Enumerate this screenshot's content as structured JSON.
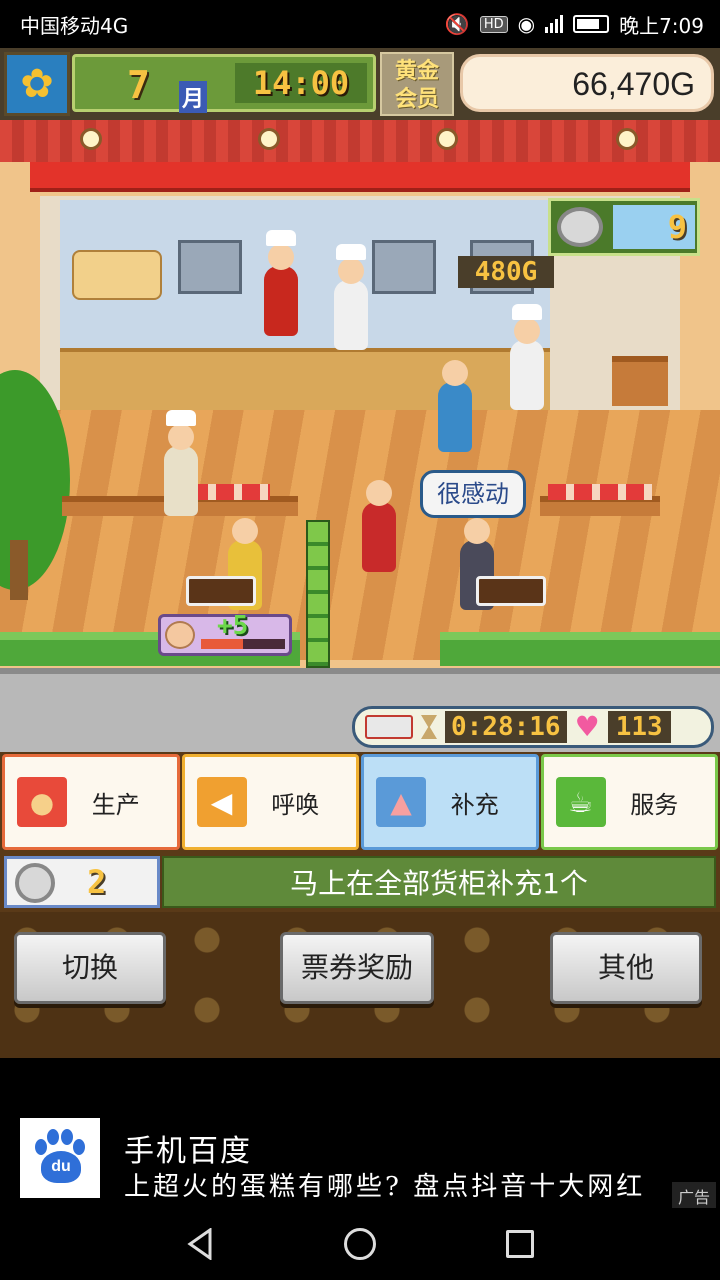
{
  "status_bar": {
    "carrier": "中国移动4G",
    "network_badge": "HD",
    "signal": "4G",
    "time": "晚上7:09"
  },
  "hud": {
    "month": "7",
    "month_unit": "月",
    "clock": "14:00",
    "membership_line1": "黄金",
    "membership_line2": "会员",
    "money": "66,470G"
  },
  "scene": {
    "sale_price": "480G",
    "coin_count": "9",
    "speech_bubble": "很感动",
    "bonus": "+5",
    "satisfaction_level": 0.5,
    "timer": "0:28:16",
    "hearts": "113"
  },
  "actions": [
    {
      "label": "生产",
      "icon": "bread-icon"
    },
    {
      "label": "呼唤",
      "icon": "megaphone-icon"
    },
    {
      "label": "补充",
      "icon": "cake-icon"
    },
    {
      "label": "服务",
      "icon": "coffee-cup-icon"
    }
  ],
  "info": {
    "ticket_count": "2",
    "message": "马上在全部货柜补充1个"
  },
  "bottom_buttons": {
    "switch": "切换",
    "ticket_rewards": "票券奖励",
    "other": "其他"
  },
  "ad": {
    "title": "手机百度",
    "description": "上超火的蛋糕有哪些? 盘点抖音十大网红",
    "tag": "广告",
    "logo_text": "du"
  },
  "colors": {
    "money_bg": "#fbeeda",
    "message_bg": "#5f8a3a",
    "accent_gold": "#f7c242"
  }
}
